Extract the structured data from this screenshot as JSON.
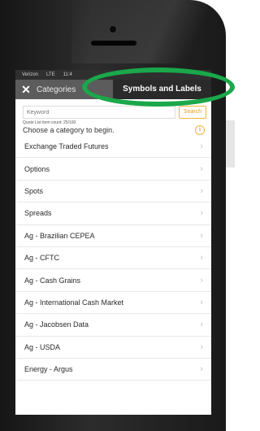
{
  "status_bar": {
    "carrier": "Verizon",
    "network": "LTE",
    "time": "11:4"
  },
  "nav": {
    "close_glyph": "✕",
    "back_label": "Categories",
    "symbols_labels_button": "Symbols and Labels"
  },
  "search": {
    "placeholder": "Keyword",
    "button_label": "Search"
  },
  "quote_list_count": "Quote List item count: 25/100",
  "instruction": "Choose a category to begin.",
  "info_glyph": "i",
  "categories": [
    "Exchange Traded Futures",
    "Options",
    "Spots",
    "Spreads",
    "Ag - Brazilian CEPEA",
    "Ag - CFTC",
    "Ag - Cash Grains",
    "Ag - International Cash Market",
    "Ag - Jacobsen Data",
    "Ag - USDA",
    "Energy - Argus"
  ],
  "chevron_glyph": "›",
  "colors": {
    "highlight_ring": "#1aa84a",
    "accent_orange": "#f2b53a",
    "navbar": "#5c5c5c"
  }
}
